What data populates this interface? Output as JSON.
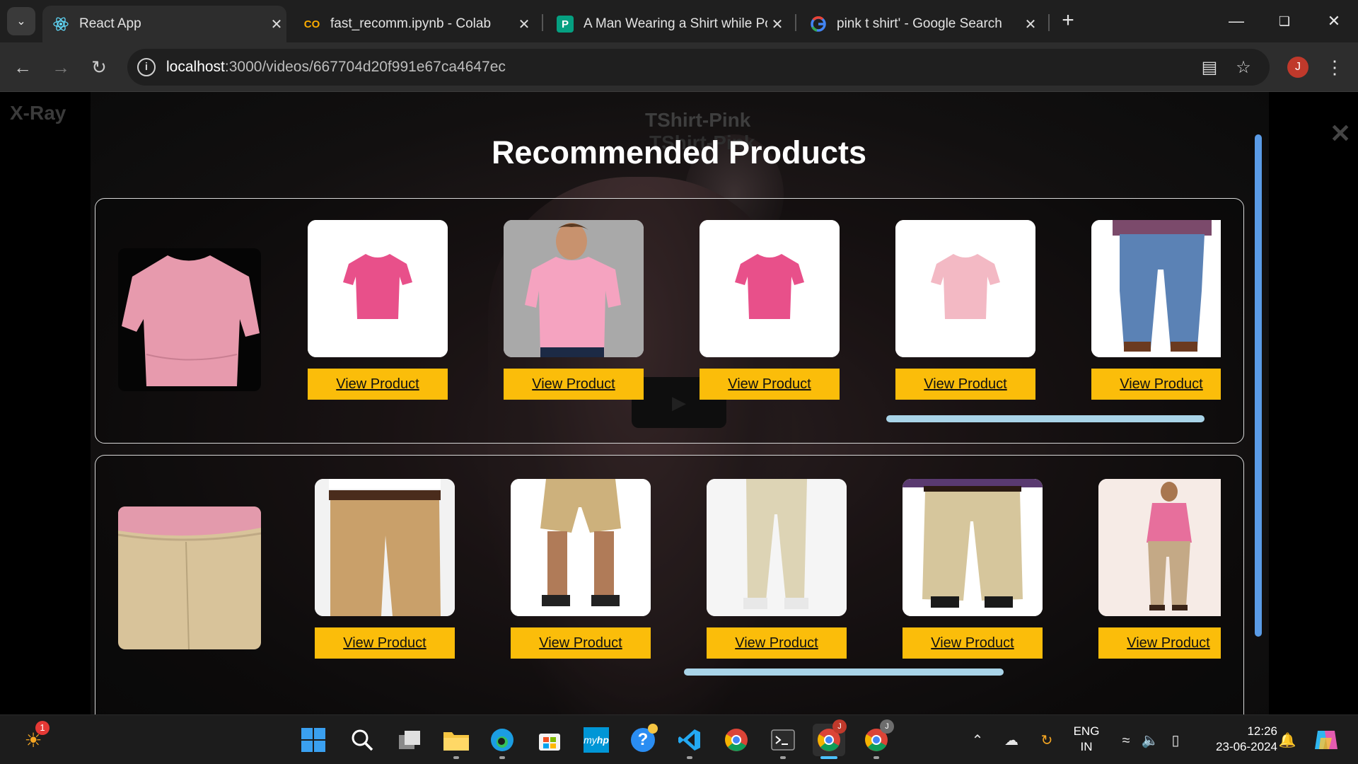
{
  "browser": {
    "tabs": [
      {
        "title": "React App",
        "favicon": "react-icon",
        "active": true
      },
      {
        "title": "fast_recomm.ipynb - Colab",
        "favicon": "colab-icon",
        "active": false
      },
      {
        "title": "A Man Wearing a Shirt while Po",
        "favicon": "pexels-icon",
        "active": false
      },
      {
        "title": "pink t shirt' - Google Search",
        "favicon": "google-icon",
        "active": false
      }
    ],
    "url_host": "localhost",
    "url_path": ":3000/videos/667704d20f991e67ca4647ec",
    "profile_initial": "J"
  },
  "page": {
    "brand": "X-Ray",
    "bg_title": "TShirt-Pink",
    "bg_title_ghost": "TShirt-Pink",
    "modal_title": "Recommended Products",
    "rows": [
      {
        "source": "pink-tshirt-crop",
        "view_label": "View Product",
        "products": [
          {
            "image": "pink-tshirt-flat",
            "button": "View Product"
          },
          {
            "image": "man-in-pink-tshirt",
            "button": "View Product"
          },
          {
            "image": "pink-tshirt-flat",
            "button": "View Product"
          },
          {
            "image": "light-pink-tshirt",
            "button": "View Product"
          },
          {
            "image": "blue-jeans",
            "button": "View Product"
          }
        ]
      },
      {
        "source": "beige-pants-crop",
        "products": [
          {
            "image": "khaki-trousers",
            "button": "View Product"
          },
          {
            "image": "khaki-shorts",
            "button": "View Product"
          },
          {
            "image": "beige-chinos",
            "button": "View Product"
          },
          {
            "image": "khaki-pants",
            "button": "View Product"
          },
          {
            "image": "man-pink-shirt-beige-pants",
            "button": "View Product"
          }
        ]
      }
    ]
  },
  "taskbar": {
    "notification_count": "1",
    "lang_line1": "ENG",
    "lang_line2": "IN",
    "time": "12:26",
    "date": "23-06-2024"
  },
  "colors": {
    "accent_button": "#fbbd0a",
    "scroll_h": "#a9d4e8",
    "scroll_v": "#5a9be6"
  }
}
